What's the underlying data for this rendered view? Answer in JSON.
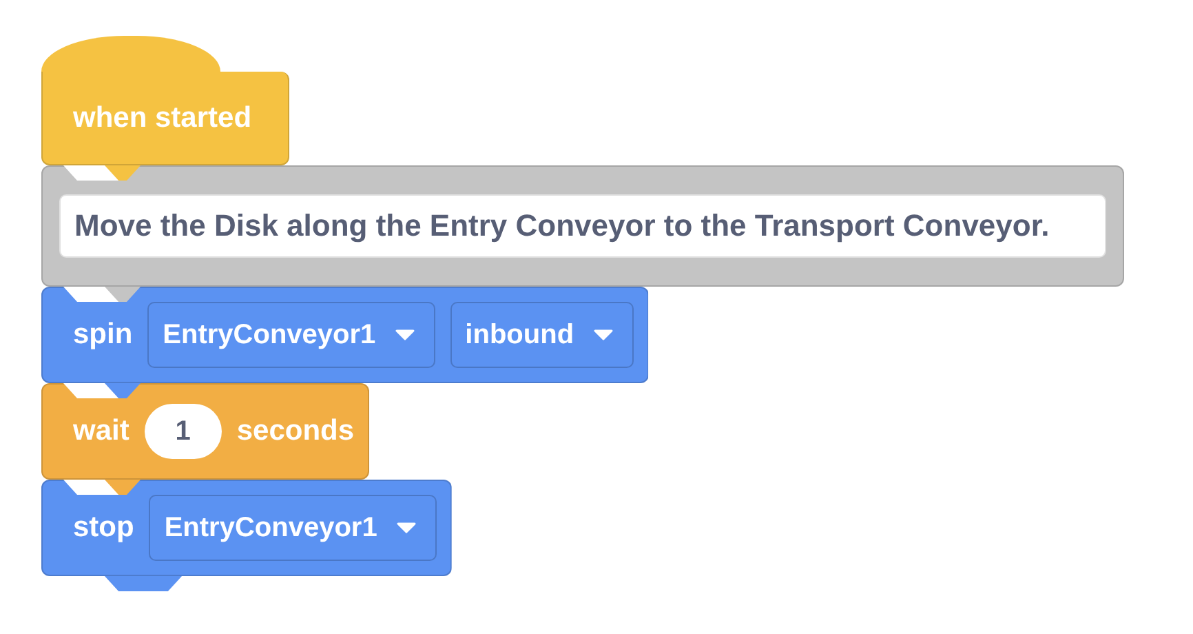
{
  "blocks": [
    {
      "kind": "hat",
      "color": "#f5c242",
      "parts": [
        {
          "kind": "label",
          "text": "when started"
        }
      ]
    },
    {
      "kind": "comment",
      "color": "#c4c4c4",
      "parts": [
        {
          "kind": "note",
          "text": "Move the Disk along the Entry Conveyor to the Transport Conveyor."
        }
      ]
    },
    {
      "kind": "command",
      "color": "#5b92f2",
      "parts": [
        {
          "kind": "label",
          "text": "spin"
        },
        {
          "kind": "dropdown",
          "text": "EntryConveyor1"
        },
        {
          "kind": "dropdown",
          "text": "inbound"
        }
      ]
    },
    {
      "kind": "command",
      "color": "#f2ae44",
      "parts": [
        {
          "kind": "label",
          "text": "wait"
        },
        {
          "kind": "number",
          "text": "1"
        },
        {
          "kind": "label",
          "text": "seconds"
        }
      ]
    },
    {
      "kind": "command",
      "color": "#5b92f2",
      "parts": [
        {
          "kind": "label",
          "text": "stop"
        },
        {
          "kind": "dropdown",
          "text": "EntryConveyor1"
        }
      ]
    }
  ]
}
